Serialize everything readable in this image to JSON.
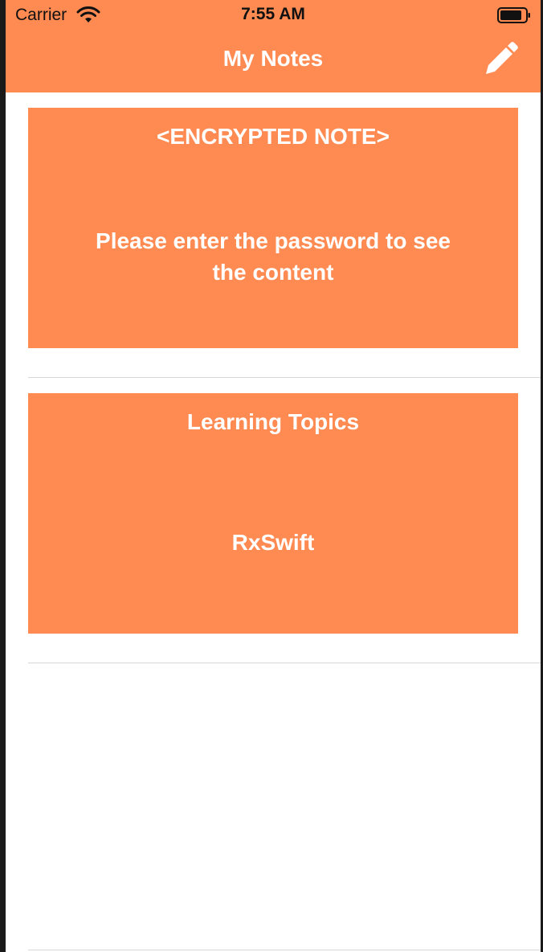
{
  "status_bar": {
    "carrier": "Carrier",
    "time": "7:55 AM",
    "wifi_icon": "wifi-icon",
    "battery_icon": "battery-icon"
  },
  "navbar": {
    "title": "My Notes",
    "edit_icon": "pencil-icon"
  },
  "colors": {
    "accent": "#FF8A52",
    "text_on_accent": "#FFFFFF",
    "background": "#FFFFFF",
    "separator": "#D6D6D6"
  },
  "notes": [
    {
      "title": "<ENCRYPTED NOTE>",
      "body": "Please enter the password to see the content"
    },
    {
      "title": "Learning Topics",
      "body": "RxSwift"
    }
  ]
}
